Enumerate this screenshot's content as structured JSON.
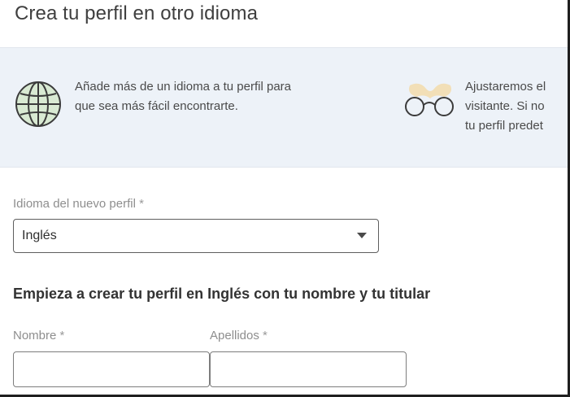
{
  "dialog": {
    "title": "Crea tu perfil en otro idioma"
  },
  "banner": {
    "item1": {
      "icon": "globe-icon",
      "line1": "Añade más de un idioma a tu perfil para",
      "line2": "que sea más fácil encontrarte."
    },
    "item2": {
      "icon": "glasses-icon",
      "line1": "Ajustaremos el",
      "line2": "visitante. Si no",
      "line3": "tu perfil predet"
    }
  },
  "form": {
    "language_label": "Idioma del nuevo perfil",
    "required_mark": "*",
    "language_selected": "Inglés",
    "section_heading": "Empieza a crear tu perfil en Inglés con tu nombre y tu titular",
    "first_name_label": "Nombre",
    "last_name_label": "Apellidos",
    "first_name_value": "",
    "last_name_value": ""
  },
  "colors": {
    "banner_bg": "#edf2f8",
    "globe_fill": "#d9ead3",
    "glasses_accent": "#f2d9a6"
  }
}
